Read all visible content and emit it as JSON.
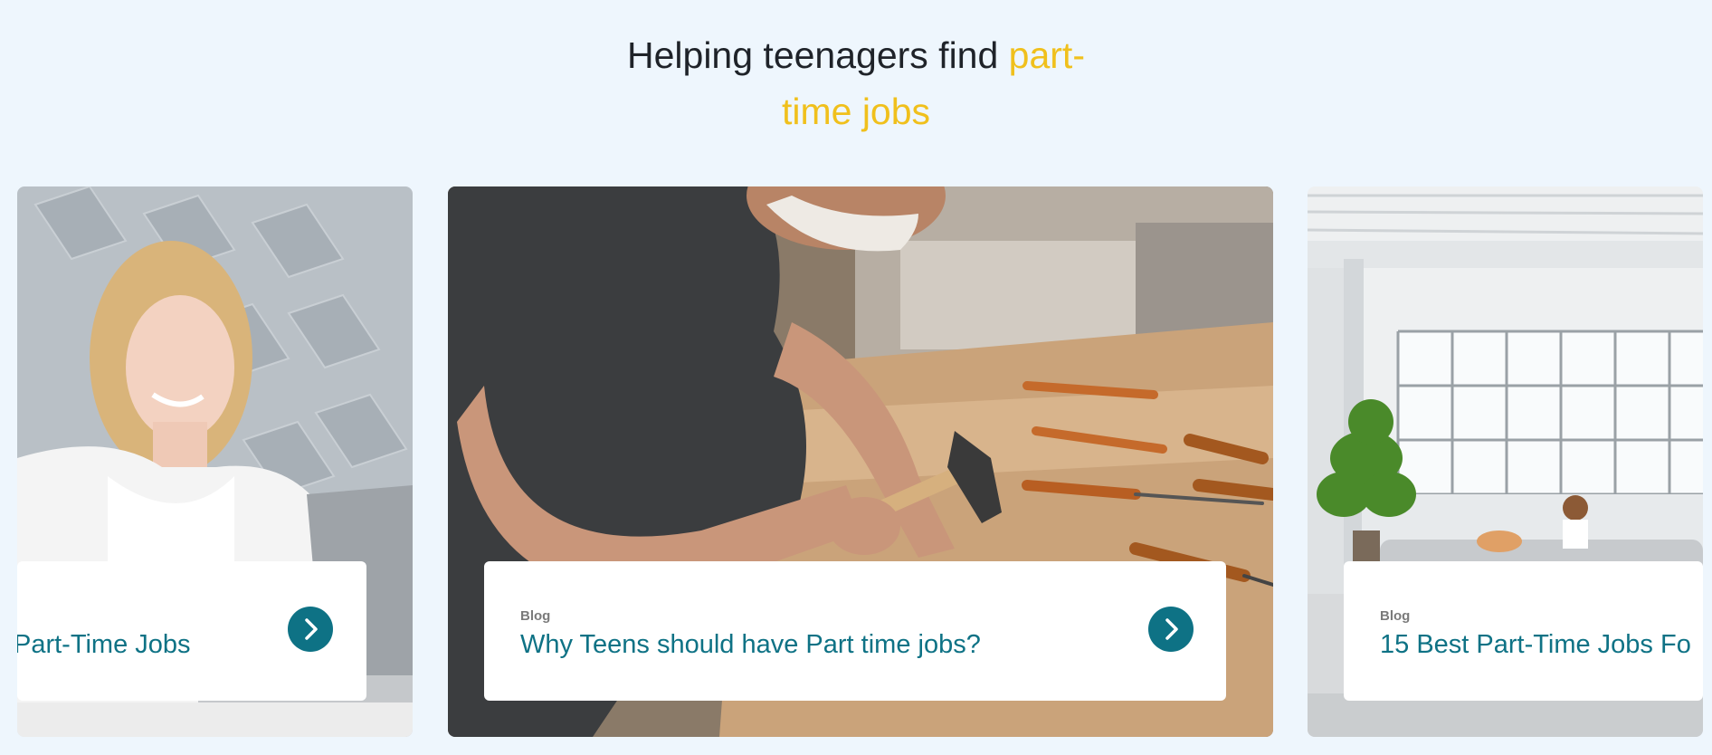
{
  "heading": {
    "text_main": "Helping teenagers find ",
    "text_accent_1": "part-",
    "text_accent_2": "time jobs"
  },
  "cards": [
    {
      "tag": "",
      "title": "Part-Time Jobs",
      "image": "woman-with-laptop-photo"
    },
    {
      "tag": "Blog",
      "title": "Why Teens should have Part time jobs?",
      "image": "teen-woodworker-photo"
    },
    {
      "tag": "Blog",
      "title": "15 Best Part-Time Jobs Fo",
      "image": "loft-living-room-photo"
    }
  ],
  "colors": {
    "background": "#eef6fd",
    "accent_yellow": "#f0c01c",
    "teal": "#0e7285",
    "heading": "#1f2329"
  },
  "icons": {
    "arrow": "chevron-right-icon"
  }
}
